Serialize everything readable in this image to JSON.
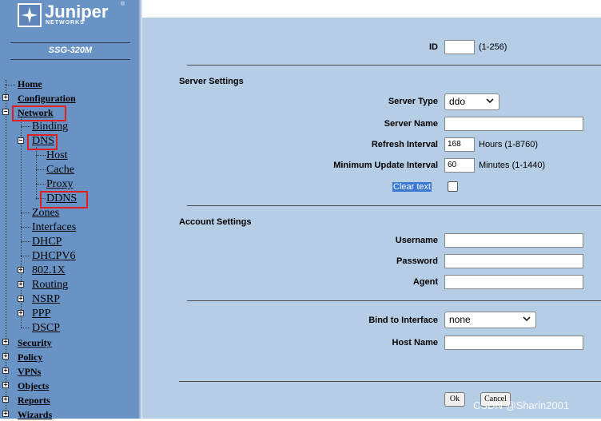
{
  "branding": {
    "name": "Juniper",
    "sub": "NETWORKS",
    "reg": "®",
    "model": "SSG-320M"
  },
  "nav": {
    "home": "Home",
    "configuration": "Configuration",
    "network": "Network",
    "binding": "Binding",
    "dns": "DNS",
    "host": "Host",
    "cache": "Cache",
    "proxy": "Proxy",
    "ddns": "DDNS",
    "zones": "Zones",
    "interfaces": "Interfaces",
    "dhcp": "DHCP",
    "dhcpv6": "DHCPV6",
    "dot1x": "802.1X",
    "routing": "Routing",
    "nsrp": "NSRP",
    "ppp": "PPP",
    "dscp": "DSCP",
    "security": "Security",
    "policy": "Policy",
    "vpns": "VPNs",
    "objects": "Objects",
    "reports": "Reports",
    "wizards": "Wizards"
  },
  "form": {
    "id_label": "ID",
    "id_value": "",
    "id_hint": "(1-256)",
    "server_settings": "Server Settings",
    "server_type_label": "Server Type",
    "server_type_value": "ddo",
    "server_name_label": "Server Name",
    "server_name_value": "",
    "refresh_label": "Refresh Interval",
    "refresh_value": "168",
    "refresh_hint": "Hours (1-8760)",
    "min_update_label": "Minimum Update Interval",
    "min_update_value": "60",
    "min_update_hint": "Minutes (1-1440)",
    "clear_text_label": "Clear text",
    "account_settings": "Account Settings",
    "username_label": "Username",
    "password_label": "Password",
    "agent_label": "Agent",
    "bind_label": "Bind to Interface",
    "bind_value": "none",
    "host_name_label": "Host Name",
    "ok": "Ok",
    "cancel": "Cancel"
  },
  "watermark": "CSDN @Sharin2001",
  "colors": {
    "sidebar": "#6a93c5",
    "content": "#b6cde6",
    "highlight_box": "#e02020"
  }
}
